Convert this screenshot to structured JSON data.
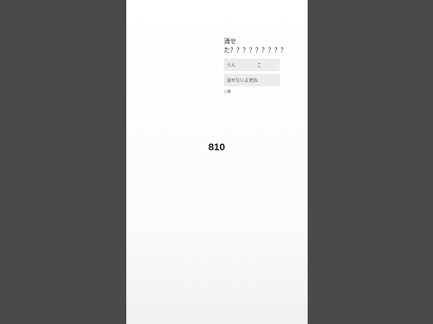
{
  "quiz": {
    "question_line1": "消せ",
    "question_line2": "た？？？？？？？？？",
    "choice_a_left": "うん",
    "choice_a_right": "こ",
    "choice_b": "消せないよ死ね",
    "hint": "小書"
  },
  "center_number": "810",
  "colors": {
    "outer_background": "#4a4a4a",
    "phone_background": "#ffffff",
    "choice_background": "#ececec"
  }
}
